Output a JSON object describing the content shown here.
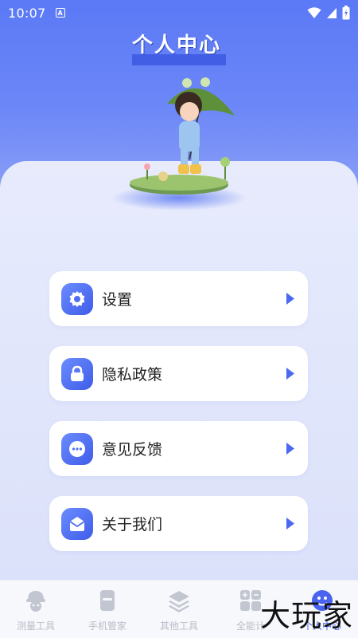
{
  "status": {
    "time": "10:07",
    "notif_letter": "A"
  },
  "header": {
    "title": "个人中心"
  },
  "menu": [
    {
      "label": "设置",
      "icon": "gear-icon"
    },
    {
      "label": "隐私政策",
      "icon": "lock-icon"
    },
    {
      "label": "意见反馈",
      "icon": "chat-icon"
    },
    {
      "label": "关于我们",
      "icon": "info-icon"
    }
  ],
  "tabs": [
    {
      "label": "测量工具",
      "icon": "ruler-robot-icon",
      "active": false
    },
    {
      "label": "手机管家",
      "icon": "phone-icon",
      "active": false
    },
    {
      "label": "其他工具",
      "icon": "layers-icon",
      "active": false
    },
    {
      "label": "全能计",
      "icon": "calculator-icon",
      "active": false
    },
    {
      "label": "个人中心",
      "icon": "smiley-icon",
      "active": true
    }
  ],
  "watermark": "大玩家",
  "colors": {
    "accent": "#4a63ee",
    "header_bg": "#5b79f6",
    "inactive": "#b9bdc8"
  }
}
